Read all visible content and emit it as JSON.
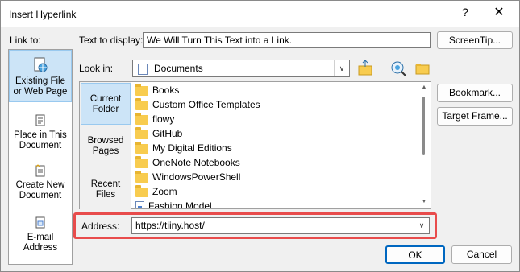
{
  "window": {
    "title": "Insert Hyperlink",
    "help_glyph": "?",
    "close_glyph": "✕"
  },
  "link_to": {
    "label": "Link to:",
    "items": [
      {
        "line1": "Existing File",
        "line2": "or Web Page"
      },
      {
        "line1": "Place in This",
        "line2": "Document"
      },
      {
        "line1": "Create New",
        "line2": "Document"
      },
      {
        "line1": "E-mail",
        "line2": "Address"
      }
    ]
  },
  "text_to_display": {
    "label": "Text to display:",
    "value": "We Will Turn This Text into a Link."
  },
  "screentip_button": "ScreenTip...",
  "look_in": {
    "label": "Look in:",
    "value": "Documents"
  },
  "sidebar": [
    {
      "line1": "Current",
      "line2": "Folder"
    },
    {
      "line1": "Browsed",
      "line2": "Pages"
    },
    {
      "line1": "Recent",
      "line2": "Files"
    }
  ],
  "files": [
    {
      "name": "Books",
      "icon": "folder-icon"
    },
    {
      "name": "Custom Office Templates",
      "icon": "folder-icon"
    },
    {
      "name": "flowy",
      "icon": "folder-icon"
    },
    {
      "name": "GitHub",
      "icon": "folder-icon"
    },
    {
      "name": "My Digital Editions",
      "icon": "folder-icon"
    },
    {
      "name": "OneNote Notebooks",
      "icon": "folder-icon"
    },
    {
      "name": "WindowsPowerShell",
      "icon": "folder-icon"
    },
    {
      "name": "Zoom",
      "icon": "folder-icon"
    },
    {
      "name": "Fashion Model",
      "icon": "document-icon"
    }
  ],
  "bookmark_button": "Bookmark...",
  "target_frame_button": "Target Frame...",
  "address": {
    "label": "Address:",
    "value": "https://tiiny.host/"
  },
  "ok_button": "OK",
  "cancel_button": "Cancel",
  "colors": {
    "highlight_box": "#e84c4c",
    "selected": "#cce4f7",
    "folder": "#f8cc4f"
  }
}
